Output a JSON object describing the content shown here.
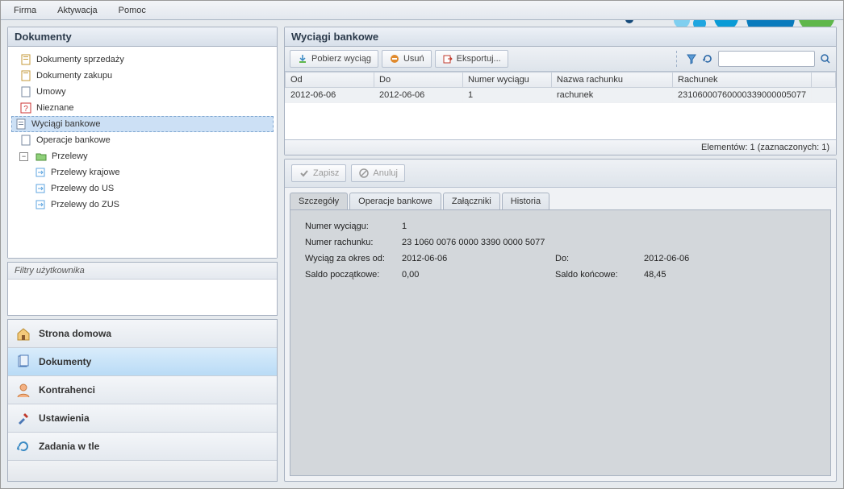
{
  "menubar": {
    "items": [
      "Firma",
      "Aktywacja",
      "Pomoc"
    ]
  },
  "left": {
    "title": "Dokumenty",
    "tree": [
      {
        "label": "Dokumenty sprzedaży",
        "icon": "doc-sale",
        "level": 1
      },
      {
        "label": "Dokumenty zakupu",
        "icon": "doc-buy",
        "level": 1
      },
      {
        "label": "Umowy",
        "icon": "doc",
        "level": 1
      },
      {
        "label": "Nieznane",
        "icon": "question",
        "level": 1
      },
      {
        "label": "Wyciągi bankowe",
        "icon": "bank-stmt",
        "level": 1,
        "selected": true
      },
      {
        "label": "Operacje bankowe",
        "icon": "bank-op",
        "level": 1
      },
      {
        "label": "Przelewy",
        "icon": "folder",
        "level": 1,
        "expander": "-"
      },
      {
        "label": "Przelewy krajowe",
        "icon": "transfer",
        "level": 2
      },
      {
        "label": "Przelewy do US",
        "icon": "transfer",
        "level": 2
      },
      {
        "label": "Przelewy do ZUS",
        "icon": "transfer",
        "level": 2
      }
    ],
    "filter_title": "Filtry użytkownika",
    "nav": [
      {
        "label": "Strona domowa",
        "icon": "home"
      },
      {
        "label": "Dokumenty",
        "icon": "docs",
        "active": true
      },
      {
        "label": "Kontrahenci",
        "icon": "person"
      },
      {
        "label": "Ustawienia",
        "icon": "tools"
      },
      {
        "label": "Zadania w tle",
        "icon": "refresh"
      }
    ]
  },
  "right": {
    "title": "Wyciągi bankowe",
    "toolbar": {
      "download": "Pobierz wyciąg",
      "delete": "Usuń",
      "export": "Eksportuj..."
    },
    "search": {
      "placeholder": ""
    },
    "columns": [
      "Od",
      "Do",
      "Numer wyciągu",
      "Nazwa rachunku",
      "Rachunek"
    ],
    "rows": [
      {
        "od": "2012-06-06",
        "do": "2012-06-06",
        "num": "1",
        "nazwa": "rachunek",
        "rach": "23106000760000339000005077"
      }
    ],
    "status": "Elementów: 1 (zaznaczonych: 1)",
    "detail_toolbar": {
      "save": "Zapisz",
      "cancel": "Anuluj"
    },
    "tabs": [
      "Szczegóły",
      "Operacje bankowe",
      "Załączniki",
      "Historia"
    ],
    "detail": {
      "labels": {
        "numer_wyciagu": "Numer wyciągu:",
        "numer_rachunku": "Numer rachunku:",
        "okres_od": "Wyciąg za okres od:",
        "do": "Do:",
        "saldo_pocz": "Saldo początkowe:",
        "saldo_konc": "Saldo końcowe:"
      },
      "values": {
        "numer_wyciagu": "1",
        "numer_rachunku": "23 1060 0076 0000 3390 0000 5077",
        "okres_od": "2012-06-06",
        "do": "2012-06-06",
        "saldo_pocz": "0,00",
        "saldo_konc": "48,45"
      }
    }
  }
}
